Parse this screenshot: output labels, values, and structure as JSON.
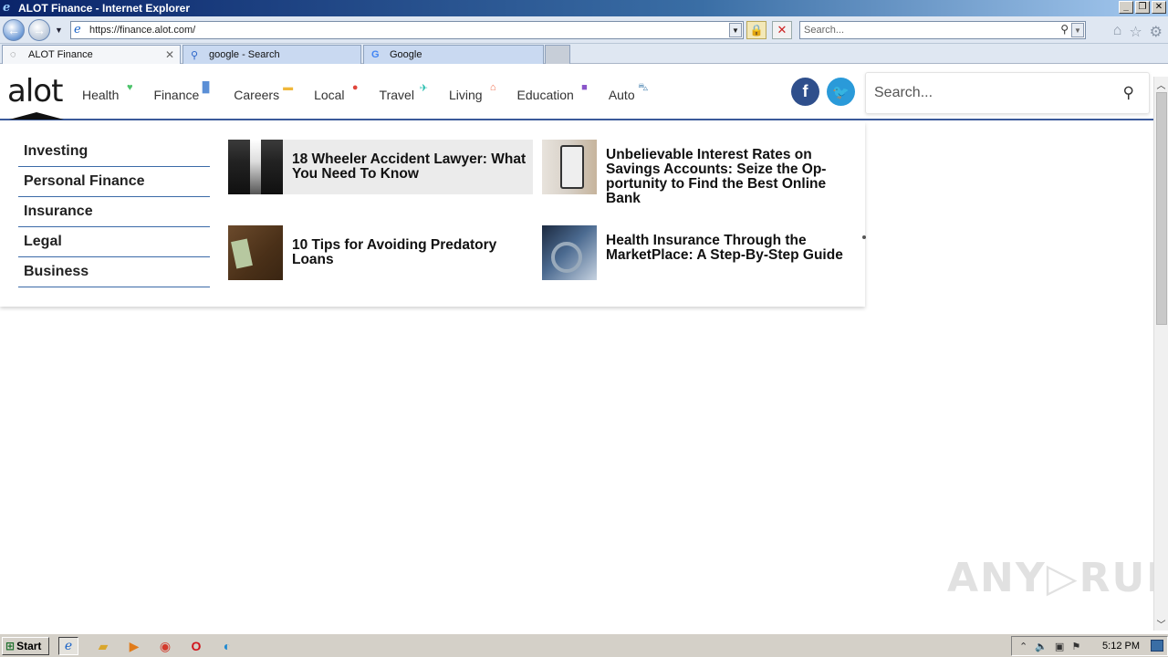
{
  "window": {
    "title": "ALOT Finance - Internet Explorer",
    "minimize_label": "_",
    "restore_label": "❐",
    "close_label": "✕"
  },
  "address_bar": {
    "url": "https://finance.alot.com/",
    "search_placeholder": "Search..."
  },
  "tabs": [
    {
      "label": "ALOT Finance",
      "icon": "loading-spinner-icon",
      "active": true
    },
    {
      "label": "google - Search",
      "icon": "search-icon",
      "active": false
    },
    {
      "label": "Google",
      "icon": "google-icon",
      "active": false
    }
  ],
  "site": {
    "logo": "alot",
    "nav": [
      {
        "label": "Health",
        "icon": "heart-icon",
        "color": "#4cc36a"
      },
      {
        "label": "Finance",
        "icon": "bar-chart-icon",
        "color": "#5b8fd6"
      },
      {
        "label": "Careers",
        "icon": "briefcase-icon",
        "color": "#f0b73a"
      },
      {
        "label": "Local",
        "icon": "map-pin-icon",
        "color": "#e0463c"
      },
      {
        "label": "Travel",
        "icon": "airplane-icon",
        "color": "#2bbfb0"
      },
      {
        "label": "Living",
        "icon": "home-icon",
        "color": "#ef6b4a"
      },
      {
        "label": "Education",
        "icon": "book-icon",
        "color": "#8a55c9"
      },
      {
        "label": "Auto",
        "icon": "car-icon",
        "color": "#5b8fb8"
      }
    ],
    "social": {
      "facebook": "f",
      "twitter": "t"
    },
    "search_placeholder": "Search..."
  },
  "dropdown": {
    "categories": [
      "Investing",
      "Personal Finance",
      "Insurance",
      "Legal",
      "Business"
    ],
    "articles": [
      {
        "title": "18 Wheeler Accident Lawyer: What You Need To Know"
      },
      {
        "title": "Unbelievable Interest Rates on Savings Accounts: Seize the Op-portunity to Find the Best Online Bank"
      },
      {
        "title": "10 Tips for Avoiding Predatory Loans"
      },
      {
        "title": "Health Insurance Through the MarketPlace: A Step-By-Step Guide"
      }
    ]
  },
  "watermark": "ANY▷RUN",
  "taskbar": {
    "start_label": "Start",
    "clock": "5:12 PM"
  }
}
